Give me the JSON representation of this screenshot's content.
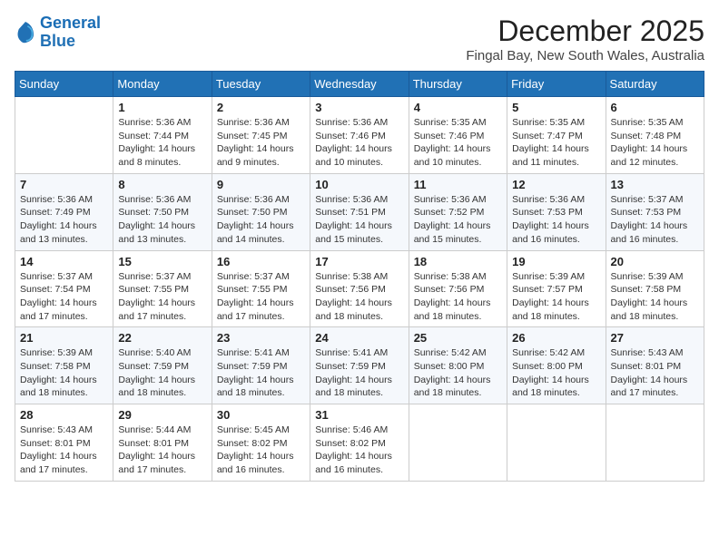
{
  "header": {
    "logo_line1": "General",
    "logo_line2": "Blue",
    "month_title": "December 2025",
    "location": "Fingal Bay, New South Wales, Australia"
  },
  "days_of_week": [
    "Sunday",
    "Monday",
    "Tuesday",
    "Wednesday",
    "Thursday",
    "Friday",
    "Saturday"
  ],
  "weeks": [
    [
      {
        "day": "",
        "content": ""
      },
      {
        "day": "1",
        "content": "Sunrise: 5:36 AM\nSunset: 7:44 PM\nDaylight: 14 hours\nand 8 minutes."
      },
      {
        "day": "2",
        "content": "Sunrise: 5:36 AM\nSunset: 7:45 PM\nDaylight: 14 hours\nand 9 minutes."
      },
      {
        "day": "3",
        "content": "Sunrise: 5:36 AM\nSunset: 7:46 PM\nDaylight: 14 hours\nand 10 minutes."
      },
      {
        "day": "4",
        "content": "Sunrise: 5:35 AM\nSunset: 7:46 PM\nDaylight: 14 hours\nand 10 minutes."
      },
      {
        "day": "5",
        "content": "Sunrise: 5:35 AM\nSunset: 7:47 PM\nDaylight: 14 hours\nand 11 minutes."
      },
      {
        "day": "6",
        "content": "Sunrise: 5:35 AM\nSunset: 7:48 PM\nDaylight: 14 hours\nand 12 minutes."
      }
    ],
    [
      {
        "day": "7",
        "content": "Sunrise: 5:36 AM\nSunset: 7:49 PM\nDaylight: 14 hours\nand 13 minutes."
      },
      {
        "day": "8",
        "content": "Sunrise: 5:36 AM\nSunset: 7:50 PM\nDaylight: 14 hours\nand 13 minutes."
      },
      {
        "day": "9",
        "content": "Sunrise: 5:36 AM\nSunset: 7:50 PM\nDaylight: 14 hours\nand 14 minutes."
      },
      {
        "day": "10",
        "content": "Sunrise: 5:36 AM\nSunset: 7:51 PM\nDaylight: 14 hours\nand 15 minutes."
      },
      {
        "day": "11",
        "content": "Sunrise: 5:36 AM\nSunset: 7:52 PM\nDaylight: 14 hours\nand 15 minutes."
      },
      {
        "day": "12",
        "content": "Sunrise: 5:36 AM\nSunset: 7:53 PM\nDaylight: 14 hours\nand 16 minutes."
      },
      {
        "day": "13",
        "content": "Sunrise: 5:37 AM\nSunset: 7:53 PM\nDaylight: 14 hours\nand 16 minutes."
      }
    ],
    [
      {
        "day": "14",
        "content": "Sunrise: 5:37 AM\nSunset: 7:54 PM\nDaylight: 14 hours\nand 17 minutes."
      },
      {
        "day": "15",
        "content": "Sunrise: 5:37 AM\nSunset: 7:55 PM\nDaylight: 14 hours\nand 17 minutes."
      },
      {
        "day": "16",
        "content": "Sunrise: 5:37 AM\nSunset: 7:55 PM\nDaylight: 14 hours\nand 17 minutes."
      },
      {
        "day": "17",
        "content": "Sunrise: 5:38 AM\nSunset: 7:56 PM\nDaylight: 14 hours\nand 18 minutes."
      },
      {
        "day": "18",
        "content": "Sunrise: 5:38 AM\nSunset: 7:56 PM\nDaylight: 14 hours\nand 18 minutes."
      },
      {
        "day": "19",
        "content": "Sunrise: 5:39 AM\nSunset: 7:57 PM\nDaylight: 14 hours\nand 18 minutes."
      },
      {
        "day": "20",
        "content": "Sunrise: 5:39 AM\nSunset: 7:58 PM\nDaylight: 14 hours\nand 18 minutes."
      }
    ],
    [
      {
        "day": "21",
        "content": "Sunrise: 5:39 AM\nSunset: 7:58 PM\nDaylight: 14 hours\nand 18 minutes."
      },
      {
        "day": "22",
        "content": "Sunrise: 5:40 AM\nSunset: 7:59 PM\nDaylight: 14 hours\nand 18 minutes."
      },
      {
        "day": "23",
        "content": "Sunrise: 5:41 AM\nSunset: 7:59 PM\nDaylight: 14 hours\nand 18 minutes."
      },
      {
        "day": "24",
        "content": "Sunrise: 5:41 AM\nSunset: 7:59 PM\nDaylight: 14 hours\nand 18 minutes."
      },
      {
        "day": "25",
        "content": "Sunrise: 5:42 AM\nSunset: 8:00 PM\nDaylight: 14 hours\nand 18 minutes."
      },
      {
        "day": "26",
        "content": "Sunrise: 5:42 AM\nSunset: 8:00 PM\nDaylight: 14 hours\nand 18 minutes."
      },
      {
        "day": "27",
        "content": "Sunrise: 5:43 AM\nSunset: 8:01 PM\nDaylight: 14 hours\nand 17 minutes."
      }
    ],
    [
      {
        "day": "28",
        "content": "Sunrise: 5:43 AM\nSunset: 8:01 PM\nDaylight: 14 hours\nand 17 minutes."
      },
      {
        "day": "29",
        "content": "Sunrise: 5:44 AM\nSunset: 8:01 PM\nDaylight: 14 hours\nand 17 minutes."
      },
      {
        "day": "30",
        "content": "Sunrise: 5:45 AM\nSunset: 8:02 PM\nDaylight: 14 hours\nand 16 minutes."
      },
      {
        "day": "31",
        "content": "Sunrise: 5:46 AM\nSunset: 8:02 PM\nDaylight: 14 hours\nand 16 minutes."
      },
      {
        "day": "",
        "content": ""
      },
      {
        "day": "",
        "content": ""
      },
      {
        "day": "",
        "content": ""
      }
    ]
  ]
}
